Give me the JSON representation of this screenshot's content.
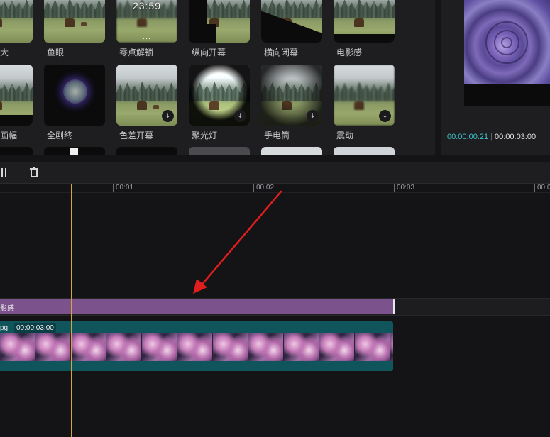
{
  "effects": {
    "row1": [
      {
        "label": "大"
      },
      {
        "label": "鱼眼"
      },
      {
        "label": "零点解锁",
        "clock_text": "23:59",
        "dots": "..."
      },
      {
        "label": "纵向开幕"
      },
      {
        "label": "横向闭幕"
      },
      {
        "label": "电影感"
      }
    ],
    "row2": [
      {
        "label": "画幅"
      },
      {
        "label": "全剧终"
      },
      {
        "label": "色差开幕",
        "download_icon": "download-icon"
      },
      {
        "label": "聚光灯",
        "download_icon": "download-icon"
      },
      {
        "label": "手电筒",
        "download_icon": "download-icon"
      },
      {
        "label": "震动",
        "download_icon": "download-icon"
      }
    ]
  },
  "preview": {
    "current_time": "00:00:00:21",
    "separator": "|",
    "total_time": "00:00:03:00"
  },
  "toolbar": {
    "split_icon": "split-icon",
    "delete_icon": "trash-icon"
  },
  "ruler": {
    "marks": [
      "00:01",
      "00:02",
      "00:03",
      "00:0"
    ]
  },
  "tracks": {
    "effect_clip_label": "影感",
    "video_clip_name": "pg",
    "video_clip_duration": "00:00:03:00"
  },
  "colors": {
    "accent_teal": "#3ec6cf",
    "effect_clip": "#7c528d",
    "video_clip": "#10545c",
    "playhead": "#d7a33c",
    "arrow": "#e01e1e"
  }
}
